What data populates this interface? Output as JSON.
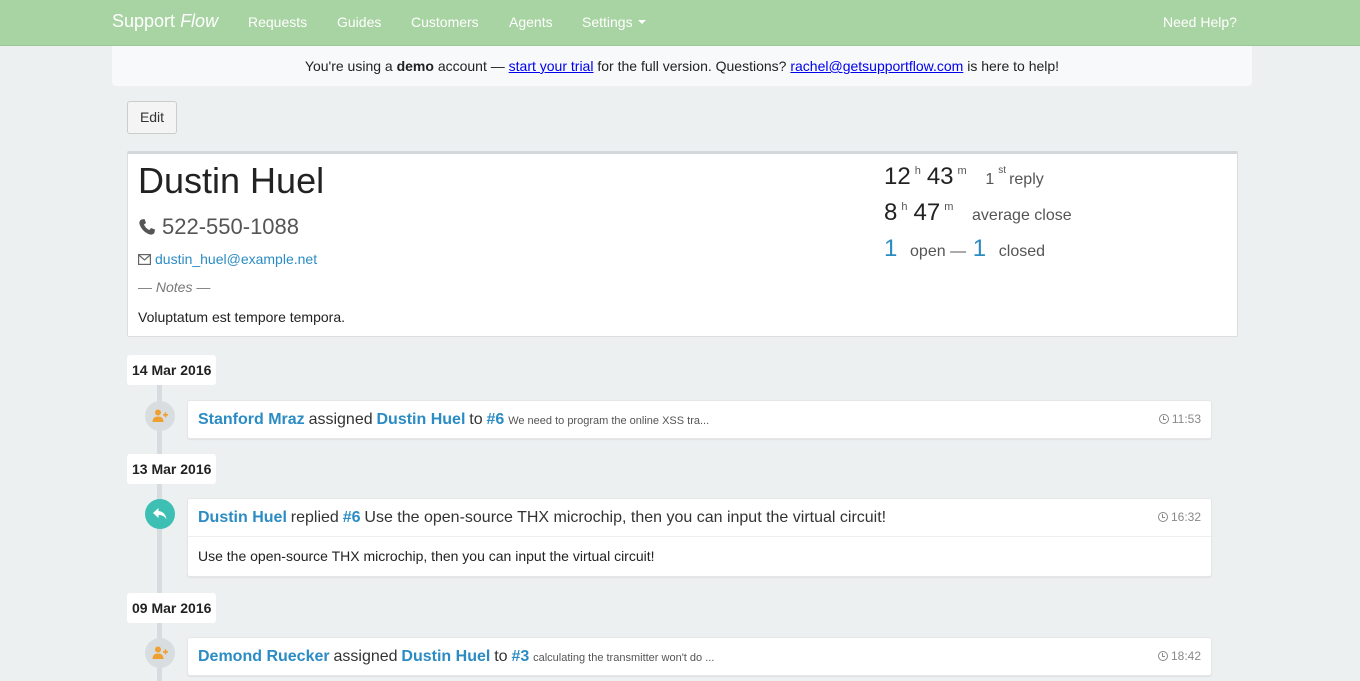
{
  "navbar": {
    "brand_main": "Support",
    "brand_em": "Flow",
    "links": [
      "Requests",
      "Guides",
      "Customers",
      "Agents",
      "Settings"
    ],
    "help": "Need Help?"
  },
  "banner": {
    "pre": "You're using a",
    "bold": "demo",
    "mid1": "account —",
    "trial_link": "start your trial",
    "mid2": "for the full version. Questions?",
    "email_link": "rachel@getsupportflow.com",
    "post": "is here to help!"
  },
  "edit_label": "Edit",
  "customer": {
    "name": "Dustin Huel",
    "phone": "522-550-1088",
    "email": "dustin_huel@example.net",
    "notes_label": "— Notes —",
    "notes": "Voluptatum est tempore tempora.",
    "first_reply": {
      "hours": "12",
      "h": "h",
      "minutes": "43",
      "m": "m",
      "ordinal": "1",
      "ordinal_sup": "st",
      "label": "reply"
    },
    "avg_close": {
      "hours": "8",
      "h": "h",
      "minutes": "47",
      "m": "m",
      "label": "average close"
    },
    "open_count": "1",
    "open_label": "open —",
    "closed_count": "1",
    "closed_label": "closed"
  },
  "timeline": [
    {
      "date": "14 Mar 2016",
      "actor": "Stanford Mraz",
      "verb": "assigned",
      "target": "Dustin Huel",
      "to": "to",
      "ticket": "#6",
      "subject": "We need to program the online XSS tra...",
      "time": "11:53",
      "icon": "user-plus-icon"
    },
    {
      "date": "13 Mar 2016",
      "actor": "Dustin Huel",
      "verb": "replied",
      "ticket": "#6",
      "subject": "Use the open-source THX microchip, then you can input the virtual circuit!",
      "time": "16:32",
      "body": "Use the open-source THX microchip, then you can input the virtual circuit!",
      "icon": "reply-icon"
    },
    {
      "date": "09 Mar 2016",
      "actor": "Demond Ruecker",
      "verb": "assigned",
      "target": "Dustin Huel",
      "to": "to",
      "ticket": "#3",
      "subject": "calculating the transmitter won't do ...",
      "time": "18:42",
      "icon": "user-plus-icon"
    }
  ],
  "colors": {
    "navbar": "#a8d3a2",
    "link": "#2b8cc4",
    "reply_icon": "#3ebfb4",
    "assign_icon": "#f0a030",
    "background": "#ecf0f1"
  }
}
